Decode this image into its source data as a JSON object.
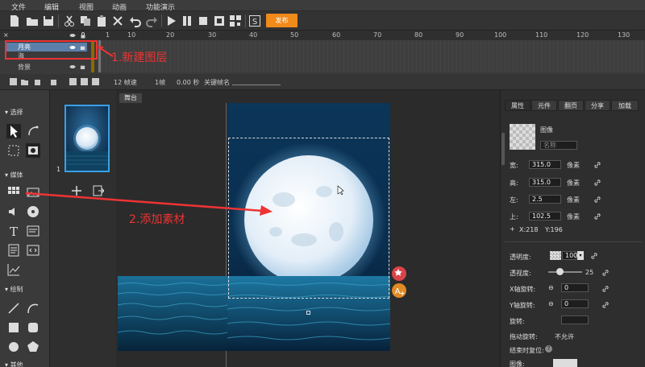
{
  "menu": [
    "文件",
    "编辑",
    "视图",
    "动画",
    "功能演示"
  ],
  "toolbar": {
    "publish_label": "发布"
  },
  "timeline": {
    "ruler_ticks": [
      "1",
      "10",
      "20",
      "30",
      "40",
      "50",
      "60",
      "70",
      "80",
      "90",
      "100",
      "110",
      "120",
      "130"
    ],
    "layers": [
      "月亮",
      "海",
      "背景"
    ],
    "annotation_1": "1.新建图层"
  },
  "statusbar": {
    "fps": "12 帧速",
    "frame": "1帧",
    "time": "0.00 秒",
    "keyframe_label": "关键帧名"
  },
  "tools": {
    "sections": [
      "选择",
      "媒体",
      "绘制",
      "其他"
    ]
  },
  "pages": {
    "number": "1"
  },
  "stage": {
    "tab": "舞台",
    "annotation_2": "2.添加素材"
  },
  "props": {
    "tabs": [
      "属性",
      "元件",
      "翻页",
      "分享",
      "加载"
    ],
    "type_label": "图像",
    "name_placeholder": "名称",
    "width_label": "宽:",
    "width_value": "315.0",
    "height_label": "高:",
    "height_value": "315.0",
    "left_label": "左:",
    "left_value": "2.5",
    "top_label": "上:",
    "top_value": "102.5",
    "unit": "像素",
    "coord_x": "X:218",
    "coord_y": "Y:196",
    "opacity_label": "透明度:",
    "opacity_value": "100",
    "depth_label": "透视度:",
    "depth_value": "25",
    "xrot_label": "X轴旋转:",
    "xrot_value": "0",
    "yrot_label": "Y轴旋转:",
    "yrot_value": "0",
    "rot_label": "旋转:",
    "drag_label": "拖动旋转:",
    "drag_value": "不允许",
    "reset_label": "结束时复位:",
    "image_label": "图像:"
  },
  "colors": {
    "accent": "#f08a1a",
    "annotation": "#e33333",
    "selection": "#3aa0e6"
  }
}
